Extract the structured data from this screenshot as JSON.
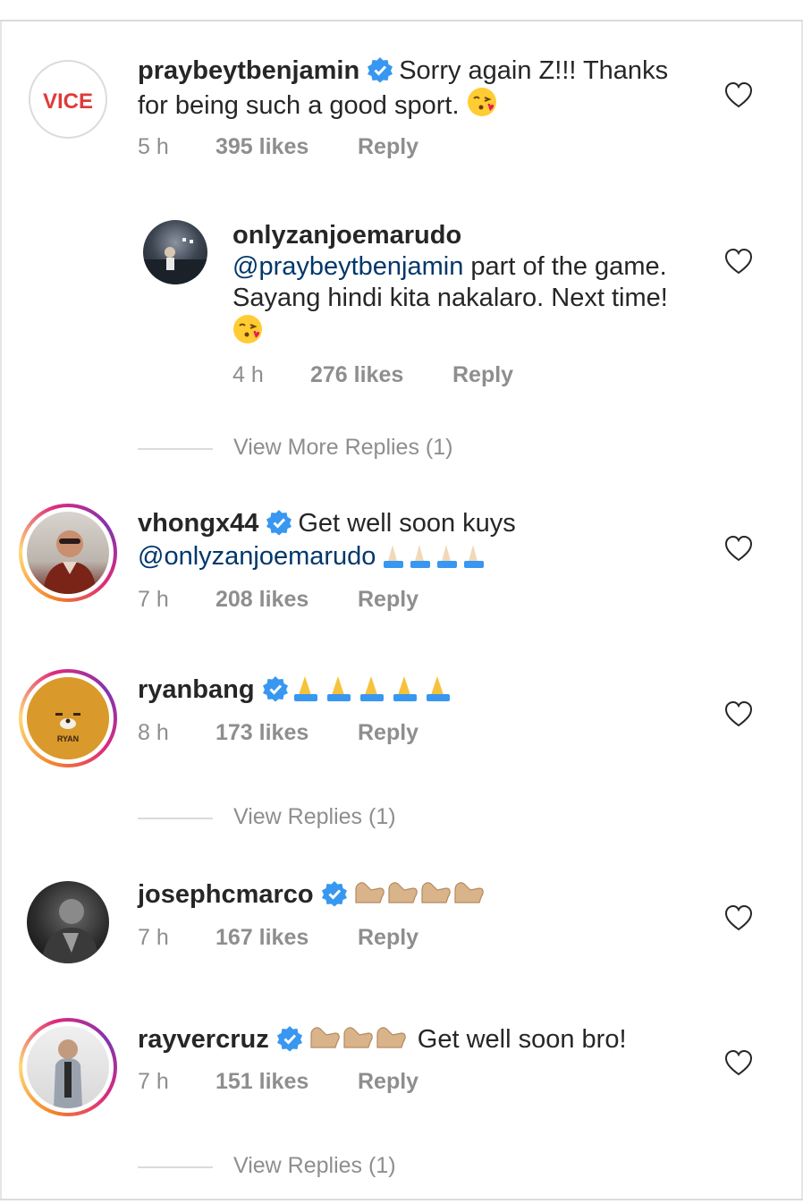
{
  "comments": [
    {
      "username": "praybeytbenjamin",
      "text": "Sorry again Z!!! Thanks",
      "text_line2": "for being such a good sport.",
      "emoji": "kiss-face",
      "time": "5 h",
      "likes": "395 likes",
      "reply": "Reply",
      "avatar_text": "VICE"
    },
    {
      "username": "onlyzanjoemarudo",
      "mention": "@praybeytbenjamin",
      "text": " part of the game.",
      "text_line2": "Sayang hindi kita nakalaro. Next time!",
      "emoji": "kiss-face",
      "time": "4 h",
      "likes": "276 likes",
      "reply": "Reply"
    },
    {
      "username": "vhongx44",
      "text": "Get well soon kuys",
      "mention": "@onlyzanjoemarudo",
      "emoji": "praying-hands-x4",
      "time": "7 h",
      "likes": "208 likes",
      "reply": "Reply"
    },
    {
      "username": "ryanbang",
      "emoji": "praying-hands-x5",
      "time": "8 h",
      "likes": "173 likes",
      "reply": "Reply",
      "avatar_text": "RYAN"
    },
    {
      "username": "josephcmarco",
      "emoji": "flexed-biceps-x4",
      "time": "7 h",
      "likes": "167 likes",
      "reply": "Reply"
    },
    {
      "username": "rayvercruz",
      "emoji": "flexed-biceps-x3",
      "text": "Get well soon bro!",
      "time": "7 h",
      "likes": "151 likes",
      "reply": "Reply"
    }
  ],
  "view_replies": {
    "first": "View More Replies (1)",
    "second": "View Replies (1)",
    "third": "View Replies (1)"
  },
  "colors": {
    "text": "#262626",
    "secondary": "#8e8e8e",
    "mention": "#00376b",
    "verified": "#3897f0"
  }
}
